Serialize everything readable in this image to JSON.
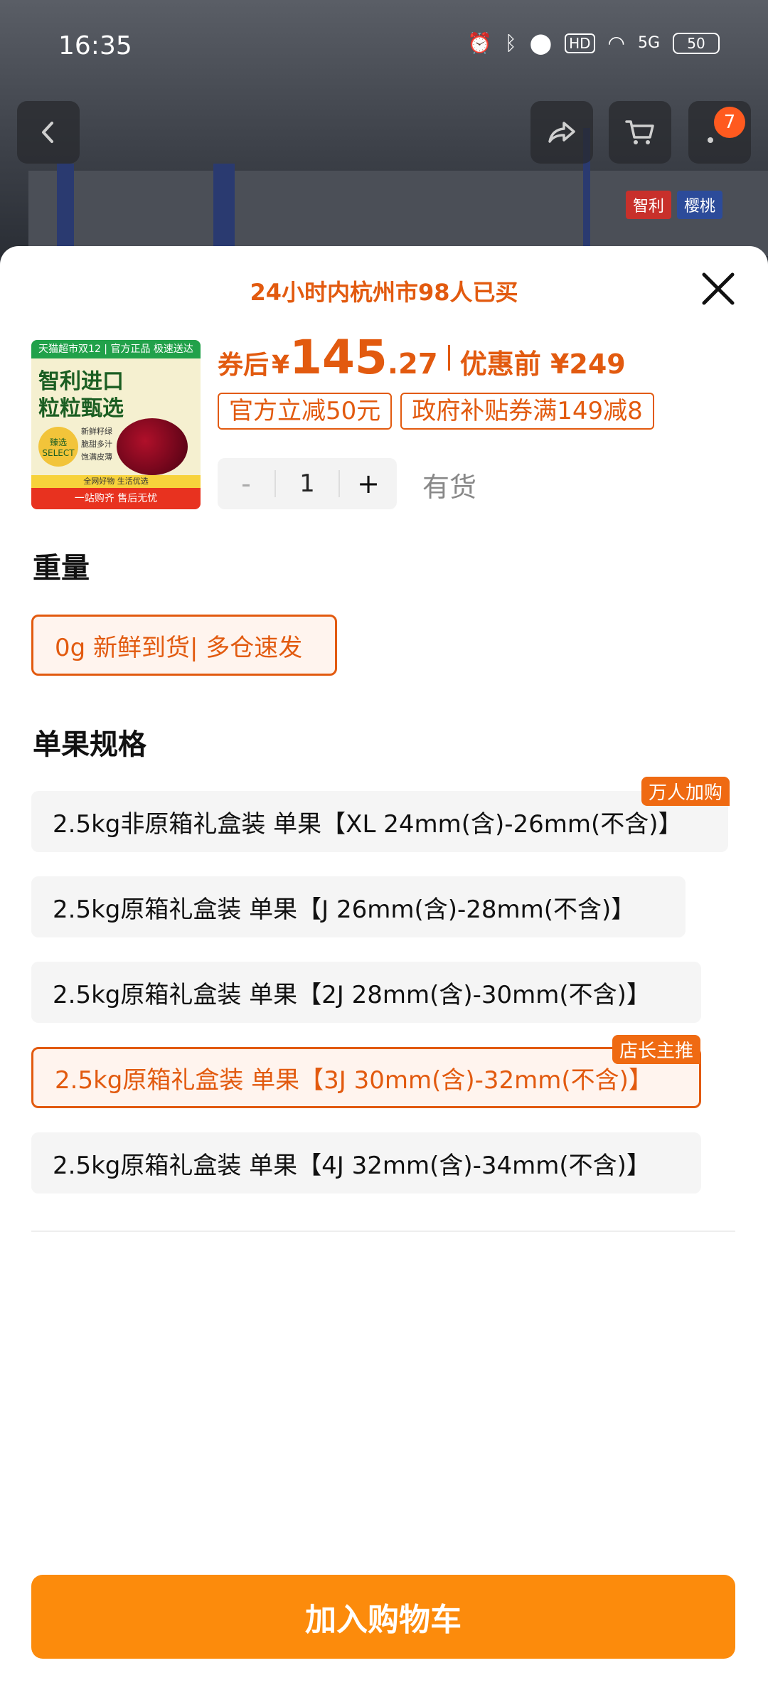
{
  "status_bar": {
    "time": "16:35",
    "net": "5G",
    "hd": "HD",
    "battery": "50"
  },
  "background": {
    "brand_tags": [
      "智利",
      "樱桃"
    ]
  },
  "nav": {
    "cart_badge": "7"
  },
  "sheet": {
    "buyers_text": "24小时内杭州市98人已买",
    "thumb": {
      "top_strip": "天猫超市双12 | 官方正品 极速送达",
      "headline": [
        "智利进口",
        "粒粒甄选"
      ],
      "select_badge": "臻选 SELECT",
      "features": [
        "新鲜籽绿",
        "脆甜多汁",
        "饱满皮薄"
      ],
      "stripe": "全网好物 生活优选",
      "bottom": "一站购齐 售后无忧"
    },
    "price": {
      "coupon_label": "券后",
      "currency": "¥",
      "integer": "145",
      "decimal": ".27",
      "pre_label": "优惠前 ¥249"
    },
    "coupons": [
      "官方立减50元",
      "政府补贴券满149减8"
    ],
    "stepper": {
      "minus": "-",
      "qty": "1",
      "plus": "+"
    },
    "stock": "有货",
    "weight": {
      "title": "重量",
      "options": [
        {
          "label": "0g 新鲜到货| 多仓速发",
          "selected": true
        }
      ]
    },
    "spec": {
      "title": "单果规格",
      "options": [
        {
          "label": "2.5kg非原箱礼盒装 单果【XL 24mm(含)-26mm(不含)】",
          "tag": "万人加购",
          "selected": false
        },
        {
          "label": "2.5kg原箱礼盒装 单果【J 26mm(含)-28mm(不含)】",
          "tag": "",
          "selected": false
        },
        {
          "label": "2.5kg原箱礼盒装 单果【2J 28mm(含)-30mm(不含)】",
          "tag": "",
          "selected": false
        },
        {
          "label": "2.5kg原箱礼盒装 单果【3J 30mm(含)-32mm(不含)】",
          "tag": "店长主推",
          "selected": true
        },
        {
          "label": "2.5kg原箱礼盒装 单果【4J 32mm(含)-34mm(不含)】",
          "tag": "",
          "selected": false
        }
      ]
    },
    "add_to_cart": "加入购物车"
  },
  "colors": {
    "accent": "#e25a0f",
    "button": "#fc8b0c"
  }
}
